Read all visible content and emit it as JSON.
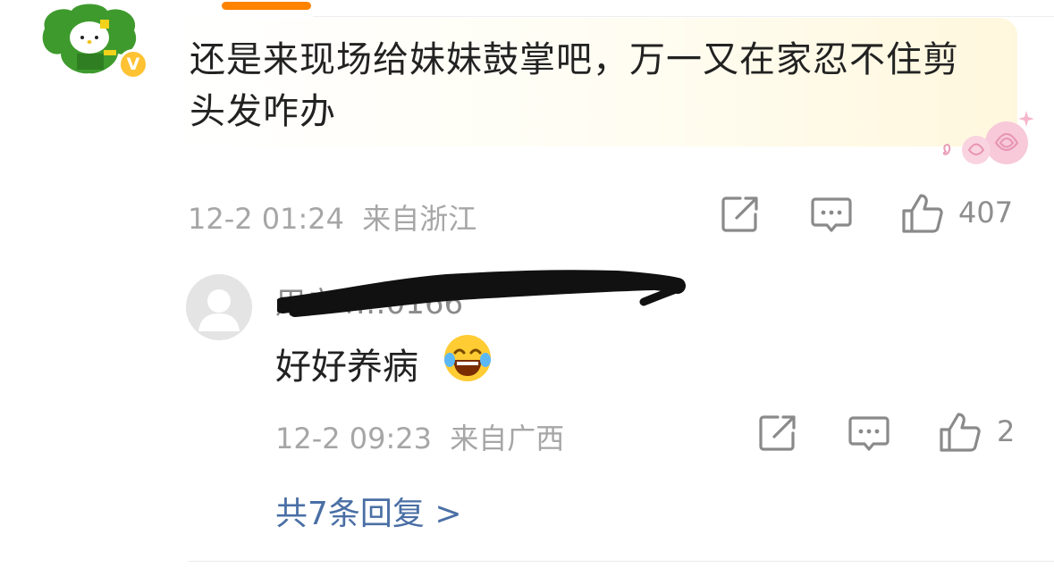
{
  "main_comment": {
    "verified_badge": "V",
    "text": "还是来现场给妹妹鼓掌吧，万一又在家忍不住剪头发咋办",
    "timestamp": "12-2 01:24",
    "location": "来自浙江",
    "likes": "407"
  },
  "reply": {
    "username": "用户4…0166",
    "text": "好好养病",
    "timestamp": "12-2 09:23",
    "location": "来自广西",
    "likes": "2"
  },
  "more_replies_label": "共7条回复 >",
  "colors": {
    "accent_orange": "#ff8200",
    "link_blue": "#4a6fa5",
    "meta_gray": "#a6a6a6",
    "badge_yellow": "#ffc233"
  },
  "icons": [
    "share-icon",
    "comment-icon",
    "like-icon",
    "laughing-crying-emoji",
    "rose-decoration",
    "sparkle-icon"
  ]
}
